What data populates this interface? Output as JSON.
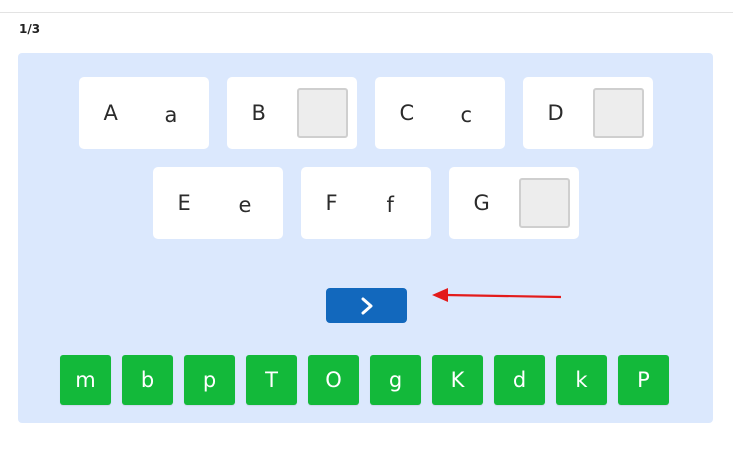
{
  "counter": "1/3",
  "pairs_row1": [
    {
      "upper": "A",
      "lower": "a",
      "filled": true
    },
    {
      "upper": "B",
      "lower": "",
      "filled": false
    },
    {
      "upper": "C",
      "lower": "c",
      "filled": true
    },
    {
      "upper": "D",
      "lower": "",
      "filled": false
    }
  ],
  "pairs_row2": [
    {
      "upper": "E",
      "lower": "e",
      "filled": true
    },
    {
      "upper": "F",
      "lower": "f",
      "filled": true
    },
    {
      "upper": "G",
      "lower": "",
      "filled": false
    }
  ],
  "next_button": {
    "icon": "chevron-right-icon"
  },
  "letter_tiles": [
    "m",
    "b",
    "p",
    "T",
    "O",
    "g",
    "K",
    "d",
    "k",
    "P"
  ],
  "colors": {
    "board": "#dbe8fd",
    "tile": "#13b93a",
    "next_button": "#1268bd",
    "annotation_arrow": "#e31b1b"
  }
}
